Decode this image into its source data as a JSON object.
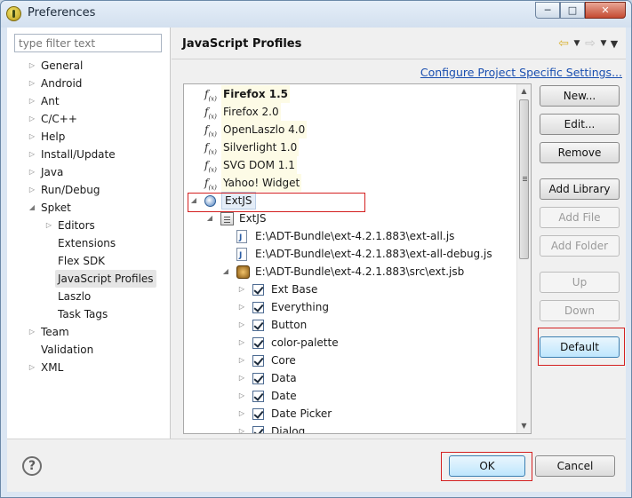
{
  "window": {
    "title": "Preferences"
  },
  "filter": {
    "placeholder": "type filter text"
  },
  "nav": {
    "items": [
      {
        "label": "General",
        "level": 0,
        "expander": "collapsed"
      },
      {
        "label": "Android",
        "level": 0,
        "expander": "collapsed"
      },
      {
        "label": "Ant",
        "level": 0,
        "expander": "collapsed"
      },
      {
        "label": "C/C++",
        "level": 0,
        "expander": "collapsed"
      },
      {
        "label": "Help",
        "level": 0,
        "expander": "collapsed"
      },
      {
        "label": "Install/Update",
        "level": 0,
        "expander": "collapsed"
      },
      {
        "label": "Java",
        "level": 0,
        "expander": "collapsed"
      },
      {
        "label": "Run/Debug",
        "level": 0,
        "expander": "collapsed"
      },
      {
        "label": "Spket",
        "level": 0,
        "expander": "expanded"
      },
      {
        "label": "Editors",
        "level": 1,
        "expander": "collapsed"
      },
      {
        "label": "Extensions",
        "level": 1,
        "expander": "none"
      },
      {
        "label": "Flex SDK",
        "level": 1,
        "expander": "none"
      },
      {
        "label": "JavaScript Profiles",
        "level": 1,
        "expander": "none",
        "selected": true
      },
      {
        "label": "Laszlo",
        "level": 1,
        "expander": "none"
      },
      {
        "label": "Task Tags",
        "level": 1,
        "expander": "none"
      },
      {
        "label": "Team",
        "level": 0,
        "expander": "collapsed"
      },
      {
        "label": "Validation",
        "level": 0,
        "expander": "none"
      },
      {
        "label": "XML",
        "level": 0,
        "expander": "collapsed"
      }
    ]
  },
  "page": {
    "title": "JavaScript Profiles",
    "link": "Configure Project Specific Settings..."
  },
  "tree": {
    "rows": [
      {
        "label": "Firefox 1.5",
        "indent": 0,
        "icon": "function-icon",
        "expander": "none",
        "bold": true,
        "highlight": true
      },
      {
        "label": "Firefox 2.0",
        "indent": 0,
        "icon": "function-icon",
        "expander": "none",
        "highlight": true
      },
      {
        "label": "OpenLaszlo 4.0",
        "indent": 0,
        "icon": "function-icon",
        "expander": "none",
        "highlight": true
      },
      {
        "label": "Silverlight 1.0",
        "indent": 0,
        "icon": "function-icon",
        "expander": "none",
        "highlight": true
      },
      {
        "label": "SVG DOM 1.1",
        "indent": 0,
        "icon": "function-icon",
        "expander": "none",
        "highlight": true
      },
      {
        "label": "Yahoo! Widget",
        "indent": 0,
        "icon": "function-icon",
        "expander": "none",
        "highlight": true
      },
      {
        "label": "ExtJS",
        "indent": 0,
        "icon": "profile-globe-icon",
        "expander": "expanded",
        "selected": true
      },
      {
        "label": "ExtJS",
        "indent": 1,
        "icon": "library-icon",
        "expander": "expanded"
      },
      {
        "label": "E:\\ADT-Bundle\\ext-4.2.1.883\\ext-all.js",
        "indent": 2,
        "icon": "js-file-icon",
        "expander": "none"
      },
      {
        "label": "E:\\ADT-Bundle\\ext-4.2.1.883\\ext-all-debug.js",
        "indent": 2,
        "icon": "js-file-icon",
        "expander": "none"
      },
      {
        "label": "E:\\ADT-Bundle\\ext-4.2.1.883\\src\\ext.jsb",
        "indent": 2,
        "icon": "jsb-package-icon",
        "expander": "expanded"
      },
      {
        "label": "Ext Base",
        "indent": 3,
        "icon": "checkbox",
        "expander": "collapsed"
      },
      {
        "label": "Everything",
        "indent": 3,
        "icon": "checkbox",
        "expander": "collapsed"
      },
      {
        "label": "Button",
        "indent": 3,
        "icon": "checkbox",
        "expander": "collapsed"
      },
      {
        "label": "color-palette",
        "indent": 3,
        "icon": "checkbox",
        "expander": "collapsed"
      },
      {
        "label": "Core",
        "indent": 3,
        "icon": "checkbox",
        "expander": "collapsed"
      },
      {
        "label": "Data",
        "indent": 3,
        "icon": "checkbox",
        "expander": "collapsed"
      },
      {
        "label": "Date",
        "indent": 3,
        "icon": "checkbox",
        "expander": "collapsed"
      },
      {
        "label": "Date Picker",
        "indent": 3,
        "icon": "checkbox",
        "expander": "collapsed"
      },
      {
        "label": "Dialog",
        "indent": 3,
        "icon": "checkbox",
        "expander": "collapsed"
      }
    ]
  },
  "buttons": {
    "new": "New...",
    "edit": "Edit...",
    "remove": "Remove",
    "add_library": "Add Library",
    "add_file": "Add File",
    "add_folder": "Add Folder",
    "up": "Up",
    "down": "Down",
    "default": "Default",
    "ok": "OK",
    "cancel": "Cancel"
  },
  "colors": {
    "link": "#1a4fb0",
    "highlight_annotation": "#d42020"
  }
}
